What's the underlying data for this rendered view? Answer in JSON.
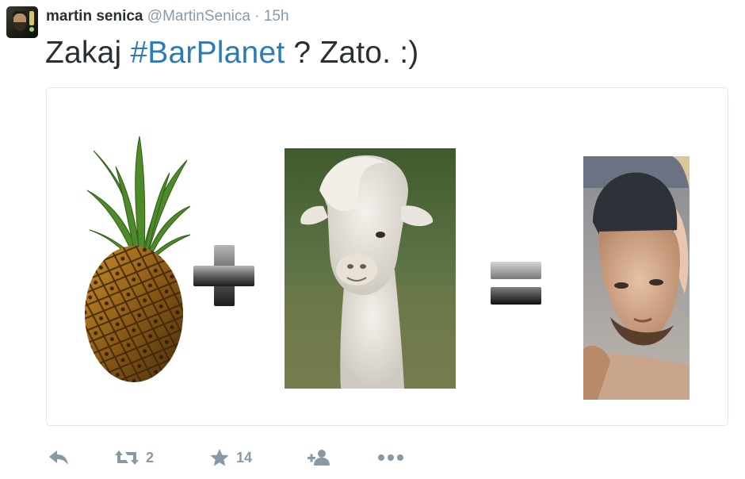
{
  "author": {
    "name": "martin senica",
    "handle": "@MartinSenica",
    "separator": "·",
    "time": "15h"
  },
  "tweet": {
    "text_before": "Zakaj ",
    "hashtag": "#BarPlanet",
    "text_after": " ? Zato. :)"
  },
  "media": {
    "items": [
      "pineapple-image",
      "plus-sign",
      "alpaca-image",
      "equals-sign",
      "selfie-photo"
    ]
  },
  "actions": {
    "reply": {
      "icon": "reply-icon"
    },
    "retweet": {
      "icon": "retweet-icon",
      "count": "2"
    },
    "favorite": {
      "icon": "star-icon",
      "count": "14"
    },
    "follow": {
      "icon": "follow-icon"
    },
    "more": {
      "icon": "more-icon"
    }
  },
  "colors": {
    "text": "#292f33",
    "muted": "#8899a6",
    "hashtag": "#2b7bb9",
    "border": "#e1e8ed"
  }
}
